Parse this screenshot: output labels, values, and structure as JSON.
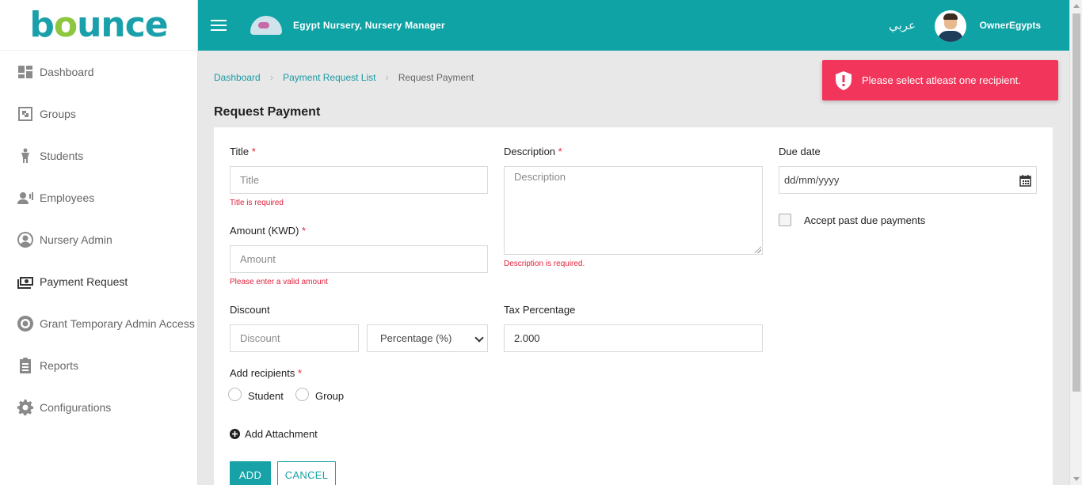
{
  "brand": {
    "logo_text_a": "b",
    "logo_text_o": "o",
    "logo_text_b": "unce"
  },
  "topbar": {
    "org_name": "Egypt Nursery, Nursery Manager",
    "language": "عربي",
    "username": "OwnerEgypts"
  },
  "sidebar": {
    "items": [
      {
        "label": "Dashboard",
        "icon": "dashboard-icon"
      },
      {
        "label": "Groups",
        "icon": "groups-icon"
      },
      {
        "label": "Students",
        "icon": "student-icon"
      },
      {
        "label": "Employees",
        "icon": "employees-icon"
      },
      {
        "label": "Nursery Admin",
        "icon": "admin-user-icon"
      },
      {
        "label": "Payment Request",
        "icon": "money-icon"
      },
      {
        "label": "Grant Temporary Admin Access",
        "icon": "lifebuoy-icon"
      },
      {
        "label": "Reports",
        "icon": "clipboard-icon"
      },
      {
        "label": "Configurations",
        "icon": "gear-icon"
      }
    ],
    "active_index": 5
  },
  "breadcrumb": [
    "Dashboard",
    "Payment Request List",
    "Request Payment"
  ],
  "page_title": "Request Payment",
  "toast": {
    "message": "Please select atleast one recipient.",
    "color": "#f2355b"
  },
  "form": {
    "title": {
      "label": "Title",
      "required": "*",
      "placeholder": "Title",
      "error": "Title is required"
    },
    "amount": {
      "label": "Amount (KWD)",
      "required": "*",
      "placeholder": "Amount",
      "error": "Please enter a valid amount"
    },
    "description": {
      "label": "Description",
      "required": "*",
      "placeholder": "Description",
      "error": "Description is required."
    },
    "due_date": {
      "label": "Due date",
      "placeholder": "dd/mm/yyyy"
    },
    "accept_past_due": {
      "label": "Accept past due payments",
      "checked": false
    },
    "discount": {
      "label": "Discount",
      "placeholder": "Discount",
      "type_selected": "Percentage (%)"
    },
    "tax": {
      "label": "Tax Percentage",
      "value": "2.000"
    },
    "recipients": {
      "label": "Add recipients",
      "required": "*",
      "options": [
        "Student",
        "Group"
      ]
    },
    "attachment_label": "Add Attachment",
    "add_button": "ADD",
    "cancel_button": "CANCEL"
  },
  "colors": {
    "accent": "#0fa3a6",
    "error": "#e0223b"
  }
}
